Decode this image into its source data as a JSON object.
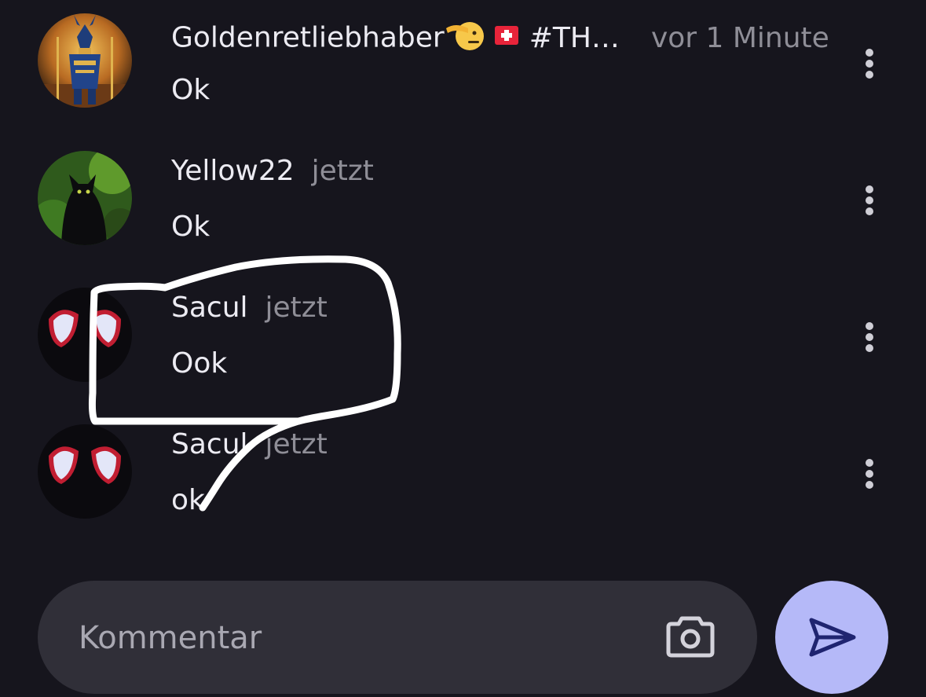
{
  "comments": [
    {
      "username": "Goldenretliebhaber",
      "username_suffix": "#TH…",
      "emojis": [
        "saluting-face-emoji",
        "swiss-flag-emoji"
      ],
      "timestamp": "vor 1 Minute",
      "text": "Ok",
      "avatar": "anubis-warrior-avatar"
    },
    {
      "username": "Yellow22",
      "timestamp": "jetzt",
      "text": "Ok",
      "avatar": "black-cat-avatar"
    },
    {
      "username": "Sacul",
      "timestamp": "jetzt",
      "text": "Ook",
      "avatar": "spiderman-mask-avatar"
    },
    {
      "username": "Sacul",
      "timestamp": "jetzt",
      "text": "ok",
      "avatar": "spiderman-mask-avatar"
    }
  ],
  "composer": {
    "placeholder": "Kommentar",
    "camera_icon": "camera-icon",
    "send_icon": "send-icon"
  },
  "colors": {
    "background": "#16151d",
    "text": "#ecebf2",
    "muted": "#8f8e97",
    "composer_bg": "#302f38",
    "send_bg": "#b5b9f8",
    "send_icon": "#1f2470",
    "annotation": "#ffffff"
  }
}
